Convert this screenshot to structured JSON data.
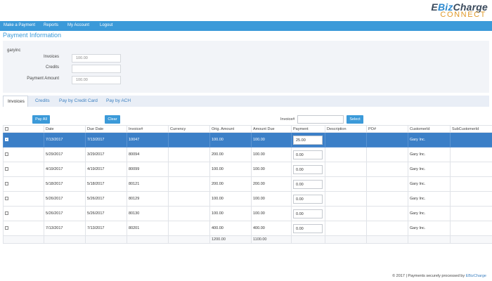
{
  "brand": {
    "logo_top_prefix": "E",
    "logo_top_accent": "Biz",
    "logo_top_suffix": "Charge",
    "logo_bottom": "CONNECT"
  },
  "nav": {
    "items": [
      {
        "label": "Make a Payment"
      },
      {
        "label": "Reports"
      },
      {
        "label": "My Account"
      },
      {
        "label": "Logout"
      }
    ]
  },
  "page_title": "Payment Information",
  "account": {
    "name": "garyinc",
    "invoices_label": "Invoices",
    "invoices_value": "100.00",
    "credits_label": "Credits",
    "credits_value": "",
    "payment_amount_label": "Payment Amount",
    "payment_amount_value": "100.00"
  },
  "tabs": [
    {
      "label": "Invoices"
    },
    {
      "label": "Credits"
    },
    {
      "label": "Pay by Credit Card"
    },
    {
      "label": "Pay by ACH"
    }
  ],
  "toolbar": {
    "pay_all_label": "Pay All",
    "clear_label": "Clear",
    "invoice_search_label": "Invoice#",
    "invoice_search_value": "",
    "select_label": "Select"
  },
  "table": {
    "columns": [
      "",
      "Date",
      "Due Date",
      "Invoice#",
      "Currency",
      "Orig. Amount",
      "Amount Due",
      "Payment",
      "Description",
      "PO#",
      "CustomerId",
      "SubCustomerId"
    ],
    "rows": [
      {
        "date": "7/13/2017",
        "due_date": "7/13/2017",
        "invoice": "10047",
        "currency": "",
        "orig_amount": "100.00",
        "amount_due": "100.00",
        "payment": "25.00",
        "description": "",
        "po": "",
        "customer": "Gary Inc.",
        "subcustomer": ""
      },
      {
        "date": "5/29/2017",
        "due_date": "3/29/2017",
        "invoice": "80094",
        "currency": "",
        "orig_amount": "200.00",
        "amount_due": "100.00",
        "payment": "0.00",
        "description": "",
        "po": "",
        "customer": "Gary Inc.",
        "subcustomer": ""
      },
      {
        "date": "4/19/2017",
        "due_date": "4/19/2017",
        "invoice": "80099",
        "currency": "",
        "orig_amount": "100.00",
        "amount_due": "100.00",
        "payment": "0.00",
        "description": "",
        "po": "",
        "customer": "Gary Inc.",
        "subcustomer": ""
      },
      {
        "date": "5/18/2017",
        "due_date": "5/18/2017",
        "invoice": "80121",
        "currency": "",
        "orig_amount": "200.00",
        "amount_due": "200.00",
        "payment": "0.00",
        "description": "",
        "po": "",
        "customer": "Gary Inc.",
        "subcustomer": ""
      },
      {
        "date": "5/26/2017",
        "due_date": "5/26/2017",
        "invoice": "80129",
        "currency": "",
        "orig_amount": "100.00",
        "amount_due": "100.00",
        "payment": "0.00",
        "description": "",
        "po": "",
        "customer": "Gary Inc.",
        "subcustomer": ""
      },
      {
        "date": "5/26/2017",
        "due_date": "5/26/2017",
        "invoice": "80130",
        "currency": "",
        "orig_amount": "100.00",
        "amount_due": "100.00",
        "payment": "0.00",
        "description": "",
        "po": "",
        "customer": "Gary Inc.",
        "subcustomer": ""
      },
      {
        "date": "7/13/2017",
        "due_date": "7/13/2017",
        "invoice": "80201",
        "currency": "",
        "orig_amount": "400.00",
        "amount_due": "400.00",
        "payment": "0.00",
        "description": "",
        "po": "",
        "customer": "Gary Inc.",
        "subcustomer": ""
      }
    ],
    "totals": {
      "orig_amount": "1200.00",
      "amount_due": "1100.00"
    }
  },
  "footer": {
    "text": "© 2017 | Payments securely processed by ",
    "link": "EBizCharge"
  },
  "colors": {
    "accent": "#3b9ad9",
    "selected_row": "#3b7fc7",
    "logo_orange": "#e09a2a",
    "panel_bg": "#f2f4f8"
  },
  "icons": {
    "row_checkbox": "checkbox-icon"
  }
}
